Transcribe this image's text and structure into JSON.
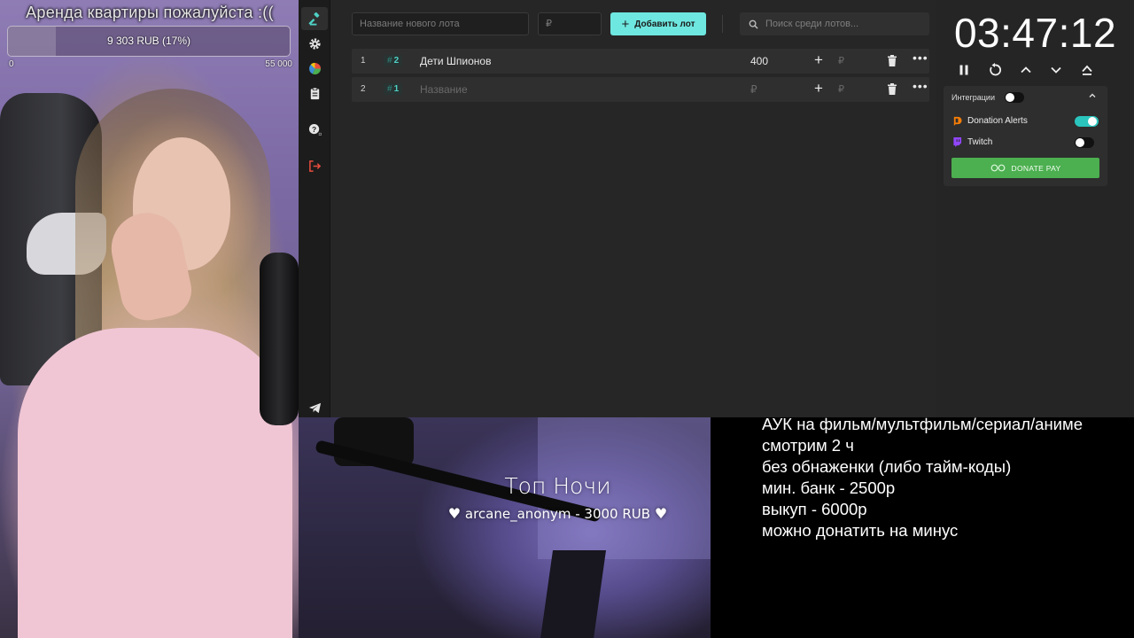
{
  "goal": {
    "title": "Аренда квартиры пожалуйста :((",
    "amount_text": "9 303 RUB (17%)",
    "progress_fraction": 0.17,
    "min_label": "0",
    "max_label": "55 000"
  },
  "sidebar": {
    "items": [
      {
        "name": "auction",
        "icon": "gavel-icon",
        "active": true
      },
      {
        "name": "settings",
        "icon": "gear-icon",
        "active": false
      },
      {
        "name": "stats",
        "icon": "pie-chart-icon",
        "active": false
      },
      {
        "name": "history",
        "icon": "clipboard-icon",
        "active": false
      },
      {
        "name": "help",
        "icon": "help-icon",
        "active": false
      },
      {
        "name": "logout",
        "icon": "logout-icon",
        "active": false
      },
      {
        "name": "telegram",
        "icon": "telegram-icon",
        "active": false
      }
    ]
  },
  "toolbar": {
    "new_lot_placeholder": "Название нового лота",
    "amount_placeholder": "₽",
    "add_label": "Добавить лот",
    "search_placeholder": "Поиск среди лотов..."
  },
  "lots": [
    {
      "index": "1",
      "badge": "2",
      "name": "Дети Шпионов",
      "amount": "400",
      "rub": "₽"
    },
    {
      "index": "2",
      "badge": "1",
      "name_placeholder": "Название",
      "amount_placeholder": "₽",
      "rub": "₽"
    }
  ],
  "timer": {
    "display": "03:47:12"
  },
  "integrations": {
    "header": "Интеграции",
    "items": [
      {
        "label": "Donation Alerts",
        "enabled": true
      },
      {
        "label": "Twitch",
        "enabled": false
      }
    ],
    "donate_pay_label": "DONATE PAY"
  },
  "top_night": {
    "title": "Топ Ночи",
    "donor": "arcane_anonym - 3000 RUB"
  },
  "rules": [
    "АУК на фильм/мультфильм/сериал/аниме",
    "смотрим 2 ч",
    "без обнаженки (либо тайм-коды)",
    "мин. банк - 2500р",
    "выкуп - 6000р",
    "можно донатить на минус"
  ],
  "colors": {
    "accent": "#6ee7e0",
    "toggle_on": "#2ac5bd",
    "donate_pay": "#4caf50",
    "badge": "#4fd1c5"
  }
}
